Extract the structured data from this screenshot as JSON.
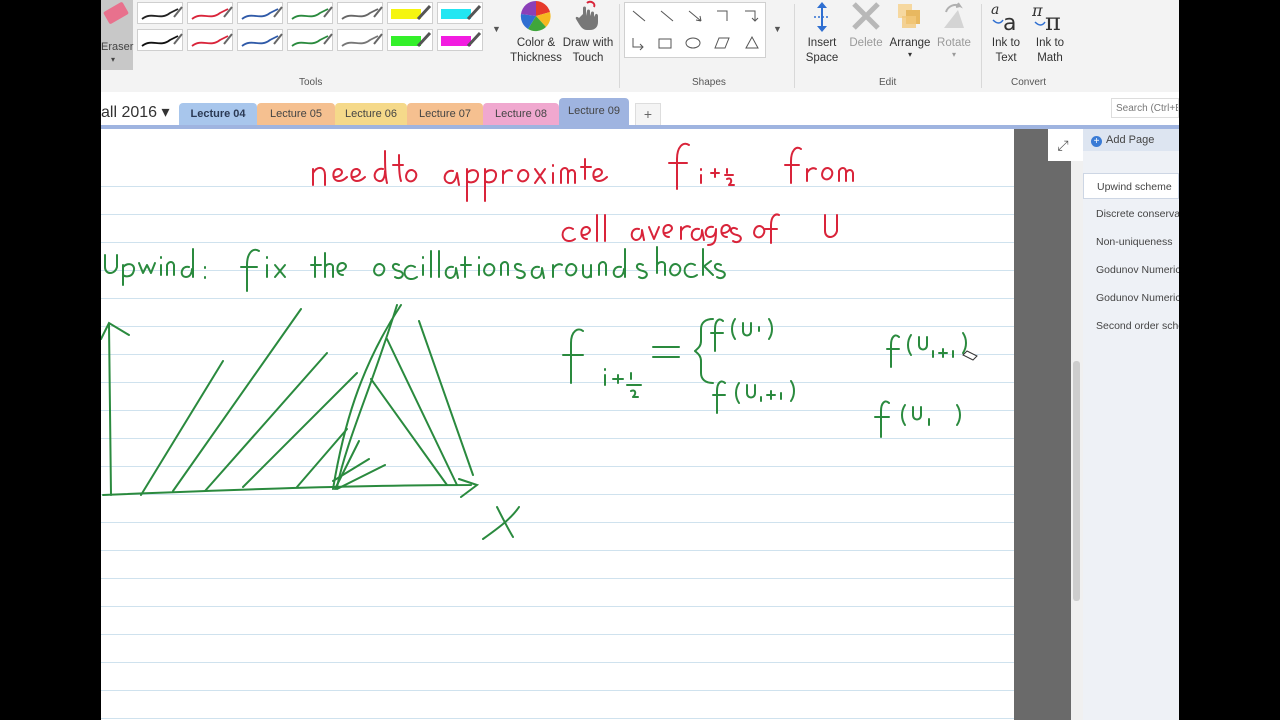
{
  "ribbon": {
    "eraser_label": "Eraser",
    "color_thickness": [
      "Color &",
      "Thickness"
    ],
    "draw_touch": [
      "Draw with",
      "Touch"
    ],
    "insert_space": [
      "Insert",
      "Space"
    ],
    "delete_label": "Delete",
    "arrange_label": "Arrange",
    "rotate_label": "Rotate",
    "ink_to_text": [
      "Ink to",
      "Text"
    ],
    "ink_to_math": [
      "Ink to",
      "Math"
    ],
    "groups": {
      "tools": "Tools",
      "shapes": "Shapes",
      "edit": "Edit",
      "convert": "Convert"
    },
    "pen_colors": [
      "#222222",
      "#d9243a",
      "#2f5aa8",
      "#2a8a3e",
      "#666666",
      "#f5f50f",
      "#22e6f2",
      "#111111",
      "#d9243a",
      "#2f5aa8",
      "#2a8a3e",
      "#777777",
      "#33f02a",
      "#f21ce0"
    ]
  },
  "notebook": {
    "title": "all 2016 ▾"
  },
  "tabs": [
    {
      "label": "Lecture 04",
      "color": "#a8c6ec"
    },
    {
      "label": "Lecture 05",
      "color": "#f5c090"
    },
    {
      "label": "Lecture 06",
      "color": "#f5d98a"
    },
    {
      "label": "Lecture 07",
      "color": "#f5c090"
    },
    {
      "label": "Lecture 08",
      "color": "#f0a8cf"
    },
    {
      "label": "Lecture 09",
      "color": "#9fb4e0"
    }
  ],
  "tab_add": "+",
  "search": {
    "placeholder": "Search (Ctrl+E)"
  },
  "pages_pane": {
    "add_page": "Add Page",
    "items": [
      "Upwind scheme",
      "Discrete conservation",
      "Non-uniqueness",
      "Godunov Numerical",
      "Godunov Numerical",
      "Second order scheme"
    ]
  },
  "ink": {
    "color_red": "#d9243a",
    "color_green": "#2a8a3e"
  }
}
